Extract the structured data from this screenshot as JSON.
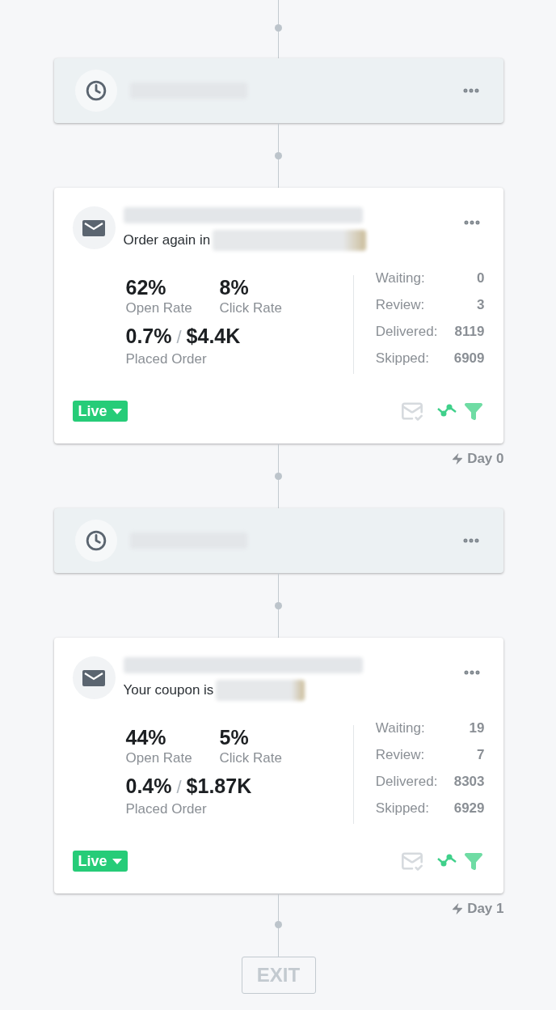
{
  "steps": [
    {
      "kind": "wait"
    },
    {
      "kind": "email",
      "subject_prefix": "Order again in",
      "open_rate": "62%",
      "open_rate_label": "Open Rate",
      "click_rate": "8%",
      "click_rate_label": "Click Rate",
      "order_rate": "0.7%",
      "separator": "/",
      "order_revenue": "$4.4K",
      "order_label": "Placed Order",
      "counts": [
        {
          "label": "Waiting:",
          "value": "0"
        },
        {
          "label": "Review:",
          "value": "3"
        },
        {
          "label": "Delivered:",
          "value": "8119"
        },
        {
          "label": "Skipped:",
          "value": "6909"
        }
      ],
      "status": "Live",
      "day": "Day 0"
    },
    {
      "kind": "wait"
    },
    {
      "kind": "email",
      "subject_prefix": "Your coupon is",
      "open_rate": "44%",
      "open_rate_label": "Open Rate",
      "click_rate": "5%",
      "click_rate_label": "Click Rate",
      "order_rate": "0.4%",
      "separator": "/",
      "order_revenue": "$1.87K",
      "order_label": "Placed Order",
      "counts": [
        {
          "label": "Waiting:",
          "value": "19"
        },
        {
          "label": "Review:",
          "value": "7"
        },
        {
          "label": "Delivered:",
          "value": "8303"
        },
        {
          "label": "Skipped:",
          "value": "6929"
        }
      ],
      "status": "Live",
      "day": "Day 1"
    }
  ],
  "exit": {
    "label": "EXIT"
  }
}
